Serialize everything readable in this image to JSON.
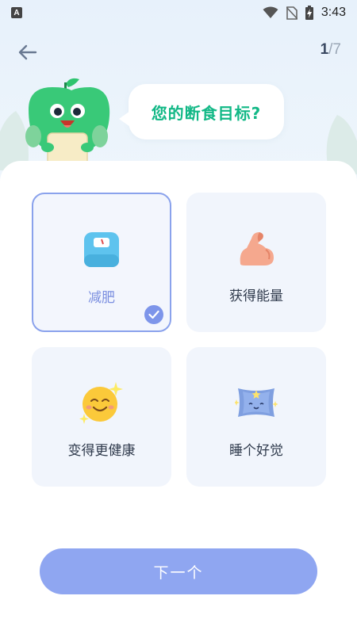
{
  "status_bar": {
    "app_icon_letter": "A",
    "time": "3:43",
    "icons": [
      "wifi-icon",
      "no-sim-icon",
      "battery-charging-icon"
    ]
  },
  "header": {
    "back_icon": "arrow-left-icon",
    "progress_current": "1",
    "progress_total": "/7"
  },
  "question": {
    "text": "您的断食目标?"
  },
  "options": [
    {
      "label": "减肥",
      "icon": "scale-icon",
      "selected": true
    },
    {
      "label": "获得能量",
      "icon": "muscle-arm-icon",
      "selected": false
    },
    {
      "label": "变得更健康",
      "icon": "smiley-sparkle-icon",
      "selected": false
    },
    {
      "label": "睡个好觉",
      "icon": "pillow-icon",
      "selected": false
    }
  ],
  "next_button": {
    "label": "下一个"
  },
  "colors": {
    "accent": "#8fa6f1",
    "selected_border": "#8aa2ec",
    "question_text": "#12b886",
    "card_bg": "#f1f5fc"
  }
}
